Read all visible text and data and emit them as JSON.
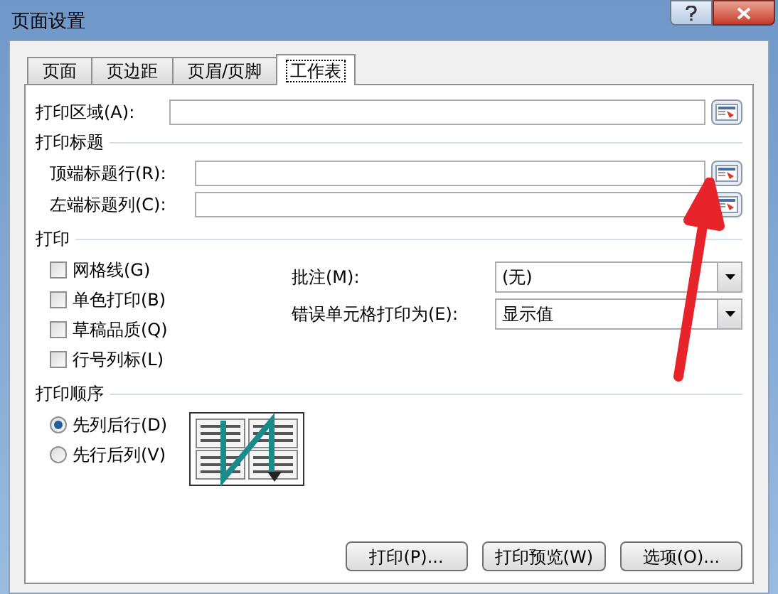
{
  "window": {
    "title": "页面设置"
  },
  "tabs": [
    {
      "label": "页面",
      "selected": false
    },
    {
      "label": "页边距",
      "selected": false
    },
    {
      "label": "页眉/页脚",
      "selected": false
    },
    {
      "label": "工作表",
      "selected": true
    }
  ],
  "print_area": {
    "label": "打印区域(A):"
  },
  "print_titles": {
    "heading": "打印标题",
    "fields": [
      {
        "label": "顶端标题行(R):"
      },
      {
        "label": "左端标题列(C):"
      }
    ]
  },
  "print": {
    "heading": "打印",
    "checkboxes": [
      {
        "label": "网格线(G)",
        "checked": false
      },
      {
        "label": "单色打印(B)",
        "checked": false
      },
      {
        "label": "草稿品质(Q)",
        "checked": false
      },
      {
        "label": "行号列标(L)",
        "checked": false
      }
    ],
    "dropdowns": [
      {
        "label": "批注(M):",
        "value": "(无)"
      },
      {
        "label": "错误单元格打印为(E):",
        "value": "显示值"
      }
    ]
  },
  "page_order": {
    "heading": "打印顺序",
    "options": [
      {
        "label": "先列后行(D)",
        "selected": true
      },
      {
        "label": "先行后列(V)",
        "selected": false
      }
    ]
  },
  "buttons": [
    "打印(P)...",
    "打印预览(W)",
    "选项(O)..."
  ]
}
